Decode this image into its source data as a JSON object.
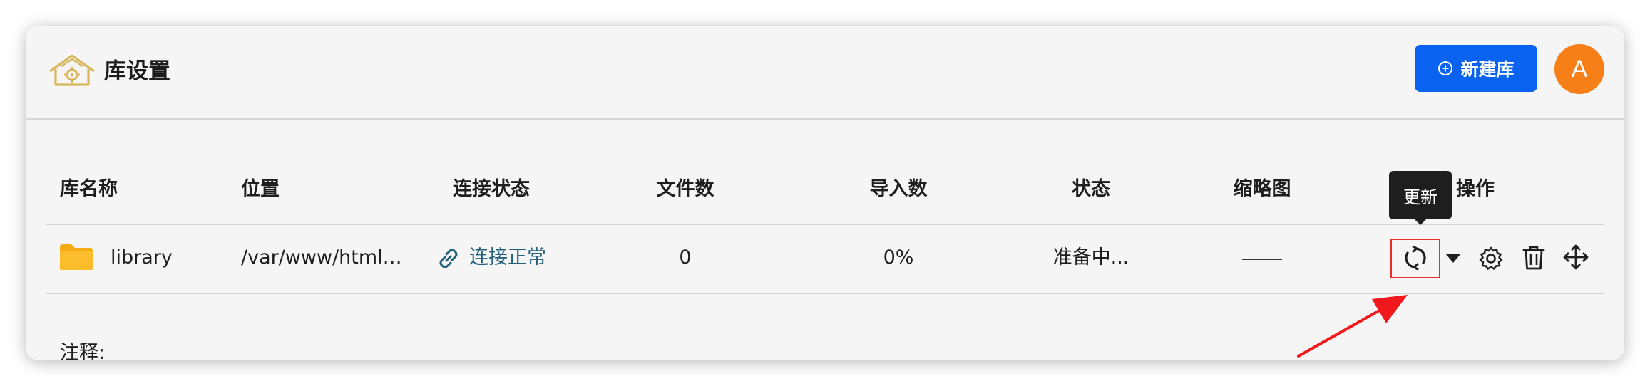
{
  "header": {
    "title": "库设置",
    "new_library_label": "新建库",
    "avatar_initial": "A"
  },
  "table": {
    "columns": [
      "库名称",
      "位置",
      "连接状态",
      "文件数",
      "导入数",
      "状态",
      "缩略图",
      "操作"
    ],
    "rows": [
      {
        "name": "library",
        "location": "/var/www/html…",
        "connection": "连接正常",
        "file_count": "0",
        "import_progress": "0%",
        "status": "准备中...",
        "thumbnail": "——"
      }
    ]
  },
  "tooltip": {
    "text": "更新"
  },
  "notes": {
    "label": "注释:"
  },
  "icons": {
    "logo": "house-gear-icon",
    "new_library": "plus-circle-icon",
    "folder": "folder-icon",
    "connection": "link-icon",
    "refresh": "refresh-icon",
    "dropdown": "caret-down-icon",
    "settings": "gear-icon",
    "delete": "trash-icon",
    "move": "move-arrows-icon"
  },
  "colors": {
    "primary_button": "#0a62f0",
    "avatar": "#f77f17",
    "connection_ok": "#24607a",
    "folder": "#fbbd2c",
    "logo": "#d9b65b",
    "highlight": "#ec2b2b"
  }
}
